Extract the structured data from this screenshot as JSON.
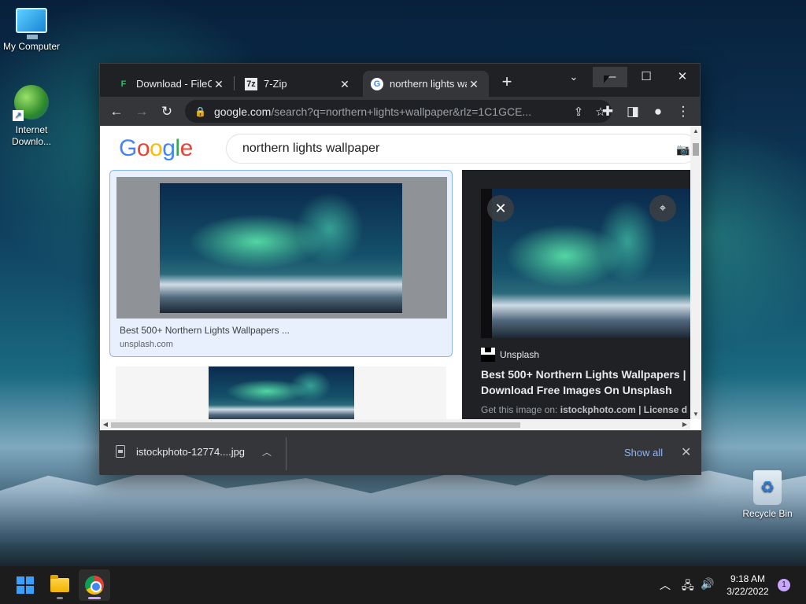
{
  "desktop": {
    "icons": [
      {
        "label": "My Computer"
      },
      {
        "label": "Internet Downlo..."
      },
      {
        "label": "Recycle Bin"
      }
    ]
  },
  "browser": {
    "tabs": [
      {
        "label": "Download - FileCR",
        "favicon": "filecr-icon",
        "active": false
      },
      {
        "label": "7-Zip",
        "favicon_text": "7z",
        "active": false
      },
      {
        "label": "northern lights wa",
        "favicon": "google-icon",
        "active": true
      }
    ],
    "window_controls": {
      "minimize": "—",
      "maximize": "☐",
      "close": "✕"
    },
    "omnibox": {
      "domain": "google.com",
      "path": "/search?q=northern+lights+wallpaper&rlz=1C1GCE..."
    }
  },
  "google": {
    "logo": [
      "G",
      "o",
      "o",
      "g",
      "l",
      "e"
    ],
    "search_query": "northern lights wallpaper"
  },
  "result": {
    "title": "Best 500+ Northern Lights Wallpapers ...",
    "source": "unsplash.com"
  },
  "preview_panel": {
    "source_name": "Unsplash",
    "title_line1": "Best 500+ Northern Lights Wallpapers |",
    "title_line2": "Download Free Images On Unsplash",
    "license_prefix": "Get this image on:",
    "license_site": "istockphoto.com",
    "license_suffix": "| License d"
  },
  "downloads_bar": {
    "filename": "istockphoto-12774....jpg",
    "show_all": "Show all"
  },
  "taskbar": {
    "time": "9:18 AM",
    "date": "3/22/2022",
    "notification_count": "1"
  },
  "colors": {
    "accent_link": "#8ab4f8",
    "chrome_dark": "#202124",
    "chrome_toolbar": "#35363a"
  }
}
